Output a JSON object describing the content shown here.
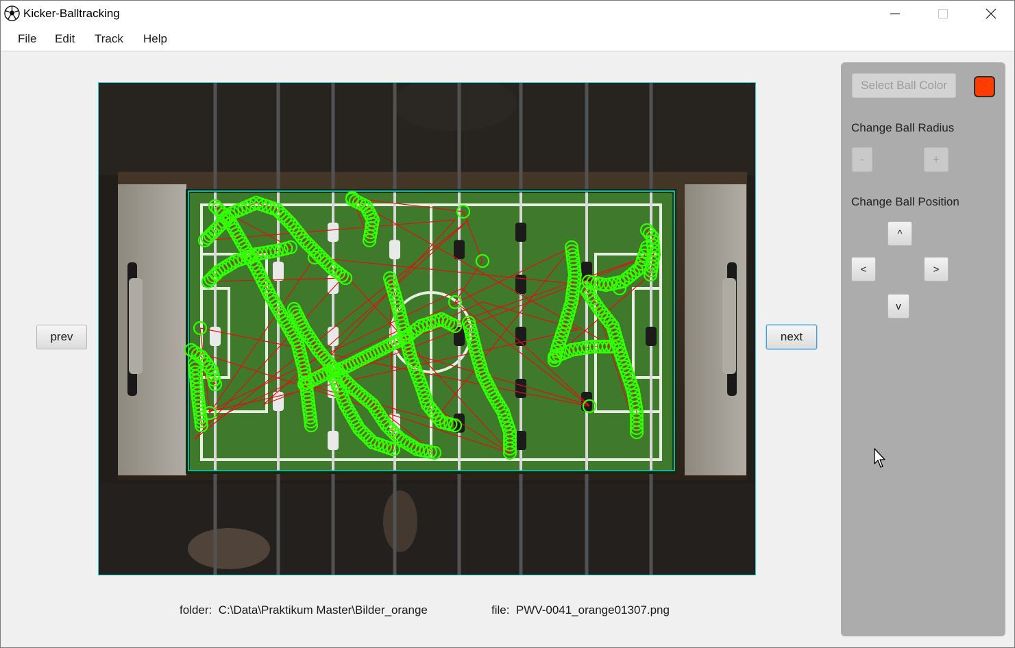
{
  "window": {
    "title": "Kicker-Balltracking",
    "controls": {
      "minimize": "─",
      "maximize": "☐",
      "close": "✕"
    }
  },
  "menu": {
    "file": "File",
    "edit": "Edit",
    "track": "Track",
    "help": "Help"
  },
  "nav": {
    "prev_label": "prev",
    "next_label": "next"
  },
  "status": {
    "folder_label": "folder:",
    "folder_value": "C:\\Data\\Praktikum Master\\Bilder_orange",
    "file_label": "file:",
    "file_value": "PWV-0041_orange01307.png"
  },
  "panel": {
    "select_color_label": "Select Ball Color",
    "ball_color": "#ff3c00",
    "radius_heading": "Change Ball Radius",
    "radius_minus": "-",
    "radius_plus": "+",
    "position_heading": "Change Ball Position",
    "up": "^",
    "left": "<",
    "right": ">",
    "down": "v"
  },
  "colors": {
    "track_circle": "#33ff00",
    "track_line": "#e01010",
    "frame_border": "#22d8e0",
    "field_green": "#3f7a2c"
  },
  "icons": {
    "app": "soccer-ball-icon",
    "cursor": "mouse-pointer-icon"
  }
}
